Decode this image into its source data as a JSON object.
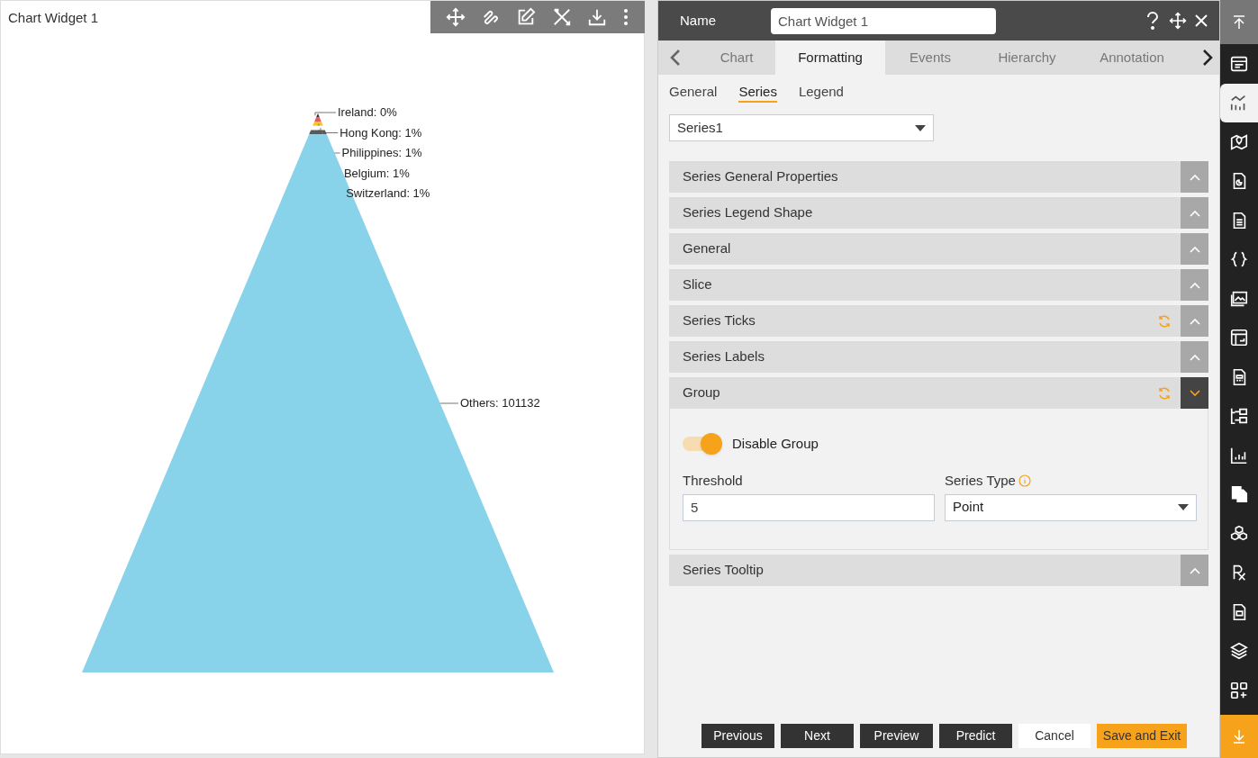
{
  "widget": {
    "title": "Chart Widget 1",
    "pyramid": {
      "slices": [
        {
          "label": "Ireland: 0%",
          "color": "#333333"
        },
        {
          "label": "Hong Kong: 1%",
          "color": "#f15c5c"
        },
        {
          "label": "Philippines: 1%",
          "color": "#f7c325"
        },
        {
          "label": "Belgium: 1%",
          "color": "#ffffff"
        },
        {
          "label": "Switzerland: 1%",
          "color": "#545b5f"
        },
        {
          "label": "Others: 101132",
          "color": "#89d3ea"
        }
      ]
    }
  },
  "panel": {
    "name_label": "Name",
    "name_value": "Chart Widget 1",
    "tabs": [
      {
        "label": "Chart",
        "selected": false
      },
      {
        "label": "Formatting",
        "selected": true
      },
      {
        "label": "Events",
        "selected": false
      },
      {
        "label": "Hierarchy",
        "selected": false
      },
      {
        "label": "Annotation",
        "selected": false
      }
    ],
    "subtabs": [
      {
        "label": "General",
        "selected": false
      },
      {
        "label": "Series",
        "selected": true
      },
      {
        "label": "Legend",
        "selected": false
      }
    ],
    "series_select": "Series1",
    "sections": [
      {
        "title": "Series General Properties",
        "expanded": false,
        "reset": false
      },
      {
        "title": "Series Legend Shape",
        "expanded": false,
        "reset": false
      },
      {
        "title": "General",
        "expanded": false,
        "reset": false
      },
      {
        "title": "Slice",
        "expanded": false,
        "reset": false
      },
      {
        "title": "Series Ticks",
        "expanded": false,
        "reset": true
      },
      {
        "title": "Series Labels",
        "expanded": false,
        "reset": false
      },
      {
        "title": "Group",
        "expanded": true,
        "reset": true
      },
      {
        "title": "Series Tooltip",
        "expanded": false,
        "reset": false
      }
    ],
    "group": {
      "toggle_label": "Disable Group",
      "toggle_on": true,
      "threshold_label": "Threshold",
      "threshold_value": "5",
      "series_type_label": "Series Type",
      "series_type_value": "Point"
    },
    "buttons": [
      {
        "label": "Previous",
        "kind": "dark"
      },
      {
        "label": "Next",
        "kind": "dark"
      },
      {
        "label": "Preview",
        "kind": "dark"
      },
      {
        "label": "Predict",
        "kind": "dark"
      },
      {
        "label": "Cancel",
        "kind": "plain"
      },
      {
        "label": "Save and Exit",
        "kind": "primary"
      }
    ]
  },
  "sidebar": {
    "items": [
      {
        "selected": false
      },
      {
        "selected": true
      },
      {
        "selected": false
      },
      {
        "selected": false
      },
      {
        "selected": false
      },
      {
        "selected": false
      },
      {
        "selected": false
      },
      {
        "selected": false
      },
      {
        "selected": false
      },
      {
        "selected": false
      },
      {
        "selected": false
      },
      {
        "selected": false
      },
      {
        "selected": false
      },
      {
        "selected": false
      },
      {
        "selected": false
      },
      {
        "selected": false
      },
      {
        "selected": false
      }
    ]
  }
}
